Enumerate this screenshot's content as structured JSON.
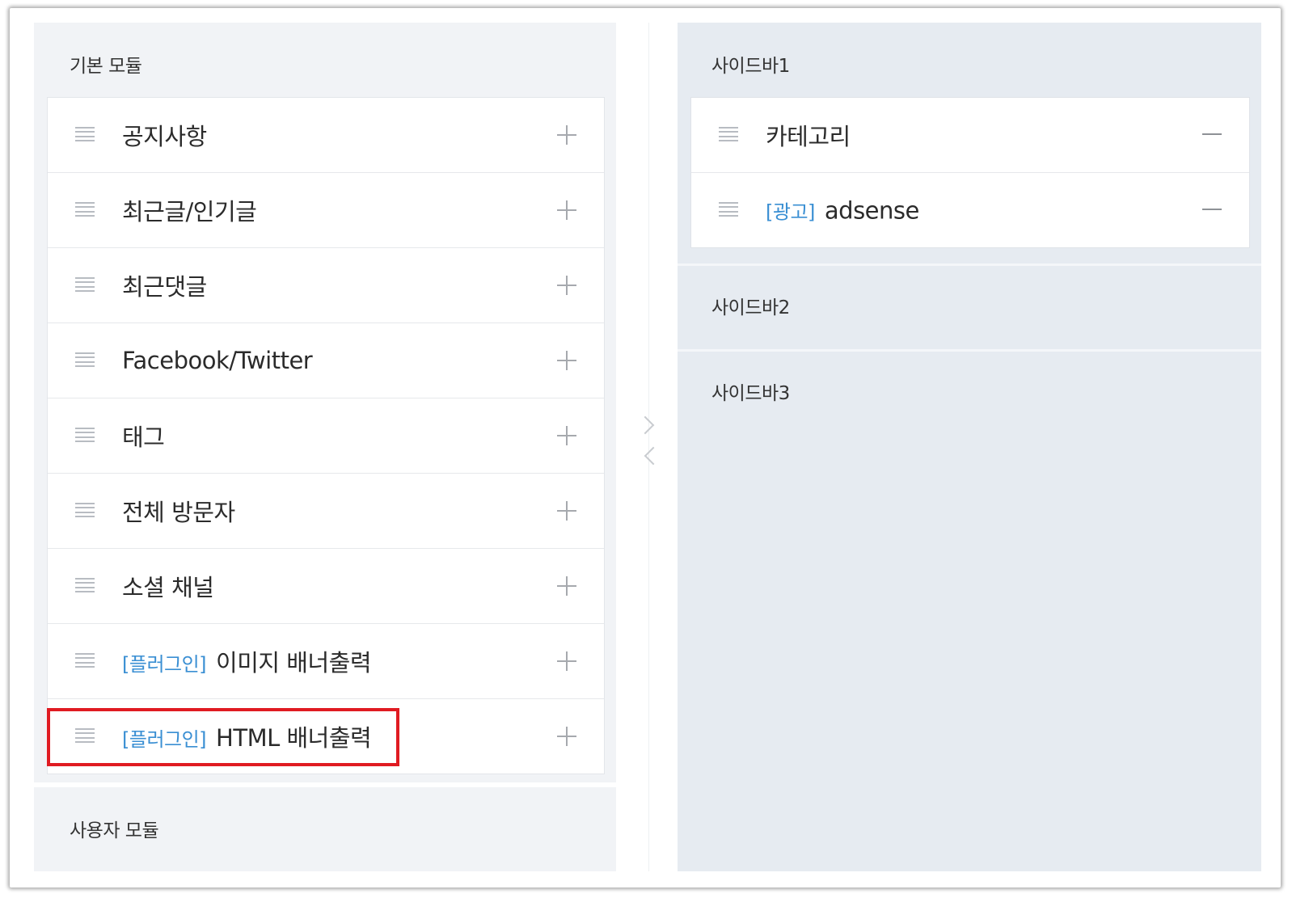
{
  "basic_module": {
    "title": "기본 모듈",
    "items": [
      {
        "label": "공지사항",
        "tag": ""
      },
      {
        "label": "최근글/인기글",
        "tag": ""
      },
      {
        "label": "최근댓글",
        "tag": ""
      },
      {
        "label": "Facebook/Twitter",
        "tag": ""
      },
      {
        "label": "태그",
        "tag": ""
      },
      {
        "label": "전체 방문자",
        "tag": ""
      },
      {
        "label": "소셜 채널",
        "tag": ""
      },
      {
        "label": "이미지 배너출력",
        "tag": "[플러그인]"
      },
      {
        "label": "HTML 배너출력",
        "tag": "[플러그인]"
      }
    ]
  },
  "user_module": {
    "title": "사용자 모듈"
  },
  "sidebars": [
    {
      "title": "사이드바1",
      "items": [
        {
          "label": "카테고리",
          "tag": ""
        },
        {
          "label": "adsense",
          "tag": "[광고]"
        }
      ]
    },
    {
      "title": "사이드바2",
      "items": []
    },
    {
      "title": "사이드바3",
      "items": []
    }
  ],
  "colors": {
    "accent_tag": "#3a8fd3",
    "highlight_border": "#e01b22",
    "left_panel_bg": "#f1f3f6",
    "right_panel_bg": "#e6ebf1"
  },
  "icons": {
    "drag_handle": "drag-handle-icon",
    "add": "plus-icon",
    "remove": "minus-icon",
    "move_right": "chevron-right-icon",
    "move_left": "chevron-left-icon"
  }
}
